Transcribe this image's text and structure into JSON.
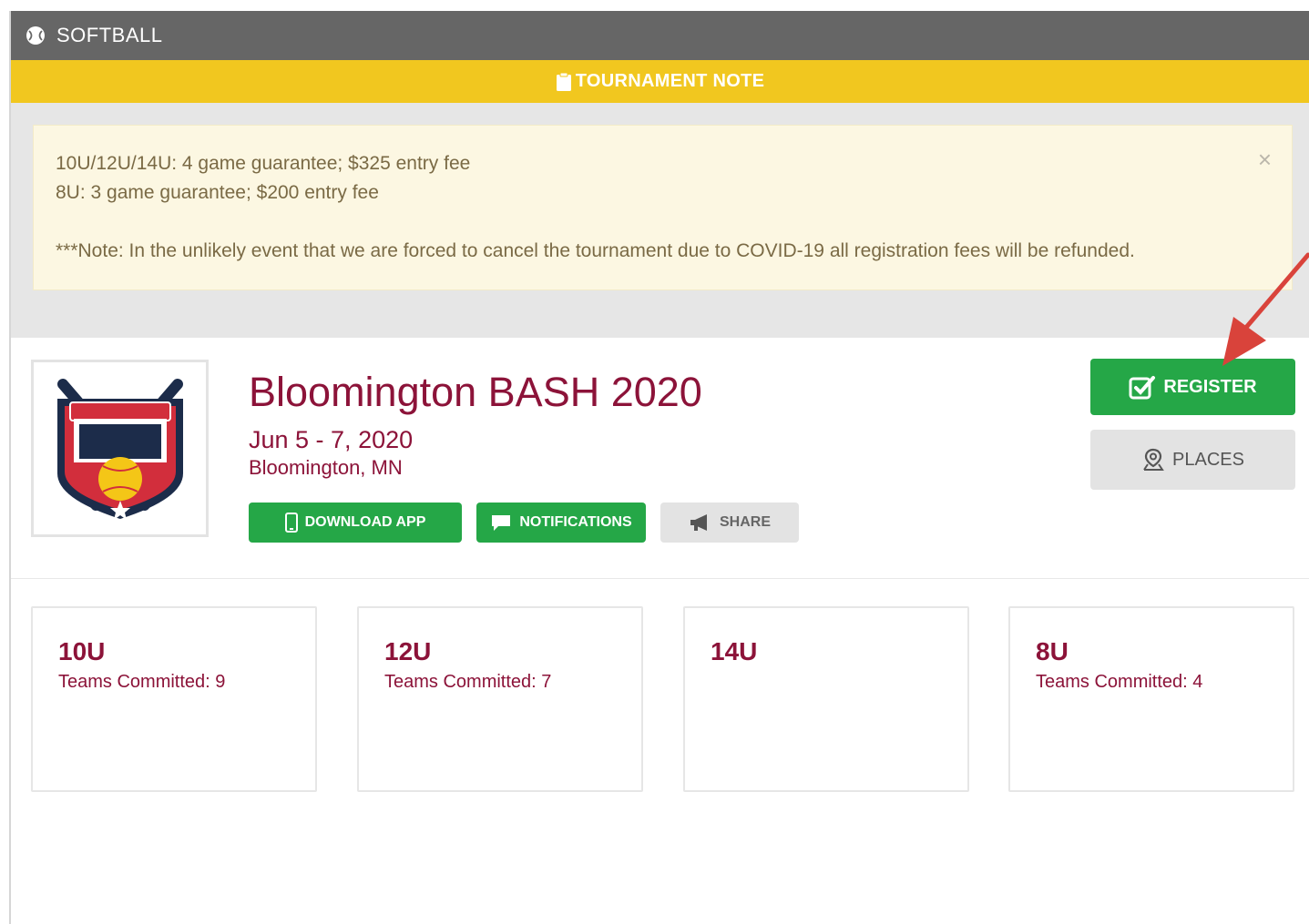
{
  "header": {
    "sport": "SOFTBALL",
    "sport_icon": "softball-icon"
  },
  "note_bar": {
    "label": "TOURNAMENT NOTE",
    "icon": "clipboard-icon"
  },
  "note": {
    "line1": "10U/12U/14U: 4 game guarantee; $325 entry fee",
    "line2": "8U: 3 game guarantee; $200 entry fee",
    "line3": "***Note: In the unlikely event that we are forced to cancel the tournament due to COVID-19 all registration fees will be refunded.",
    "close": "×"
  },
  "event": {
    "logo_icon": "bloomington-bash-logo",
    "title": "Bloomington BASH 2020",
    "dates": "Jun 5 - 7, 2020",
    "location": "Bloomington, MN",
    "actions": {
      "download_app": "DOWNLOAD APP",
      "notifications": "NOTIFICATIONS",
      "share": "SHARE",
      "register": "REGISTER",
      "places": "PLACES"
    }
  },
  "divisions": [
    {
      "name": "10U",
      "teams": "Teams Committed: 9"
    },
    {
      "name": "12U",
      "teams": "Teams Committed: 7"
    },
    {
      "name": "14U",
      "teams": ""
    },
    {
      "name": "8U",
      "teams": "Teams Committed: 4"
    }
  ],
  "colors": {
    "header_bg": "#666666",
    "note_bar_bg": "#f1c71f",
    "note_box_bg": "#fcf7e2",
    "brand_maroon": "#8c1339",
    "action_green": "#25a747",
    "annotation_red": "#d9433b"
  }
}
